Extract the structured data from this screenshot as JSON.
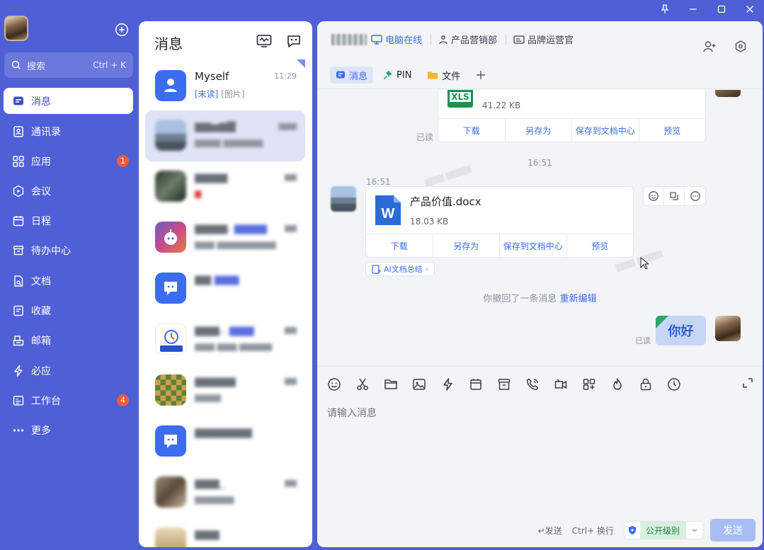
{
  "window": {
    "controls": [
      "pin-icon",
      "minimize-icon",
      "maximize-icon",
      "close-icon"
    ]
  },
  "nav": {
    "search_placeholder": "搜索",
    "search_shortcut": "Ctrl + K",
    "items": [
      {
        "id": "messages",
        "label": "消息",
        "icon": "message-icon",
        "active": true,
        "badge": ""
      },
      {
        "id": "contacts",
        "label": "通讯录",
        "icon": "contacts-icon",
        "active": false,
        "badge": ""
      },
      {
        "id": "apps",
        "label": "应用",
        "icon": "apps-grid-icon",
        "active": false,
        "badge": "1"
      },
      {
        "id": "meeting",
        "label": "会议",
        "icon": "meeting-icon",
        "active": false,
        "badge": ""
      },
      {
        "id": "calendar",
        "label": "日程",
        "icon": "calendar-icon",
        "active": false,
        "badge": ""
      },
      {
        "id": "todo",
        "label": "待办中心",
        "icon": "todo-icon",
        "active": false,
        "badge": ""
      },
      {
        "id": "docs",
        "label": "文档",
        "icon": "document-icon",
        "active": false,
        "badge": ""
      },
      {
        "id": "favorites",
        "label": "收藏",
        "icon": "favorite-icon",
        "active": false,
        "badge": ""
      },
      {
        "id": "mail",
        "label": "邮箱",
        "icon": "mail-icon",
        "active": false,
        "badge": ""
      },
      {
        "id": "ding",
        "label": "必应",
        "icon": "lightning-icon",
        "active": false,
        "badge": ""
      },
      {
        "id": "workbench",
        "label": "工作台",
        "icon": "workbench-icon",
        "active": false,
        "badge": "4"
      },
      {
        "id": "more",
        "label": "更多",
        "icon": "more-dots-icon",
        "active": false,
        "badge": ""
      }
    ]
  },
  "list": {
    "title": "消息",
    "conversations": [
      {
        "name": "Myself",
        "time": "11:29",
        "preview_tag": "[未读]",
        "preview": "[图片]",
        "blur": false
      },
      {
        "name": "",
        "time": "",
        "preview": "",
        "blur": true,
        "selected": true
      },
      {
        "name": "",
        "time": "",
        "preview": "",
        "blur": true
      },
      {
        "name": "",
        "time": "",
        "preview": "",
        "blur": true
      },
      {
        "name": "",
        "time": "",
        "preview": "",
        "blur": true
      },
      {
        "name": "",
        "time": "",
        "preview": "",
        "blur": true
      },
      {
        "name": "",
        "time": "",
        "preview": "",
        "blur": true
      },
      {
        "name": "",
        "time": "",
        "preview": "",
        "blur": true
      },
      {
        "name": "",
        "time": "",
        "preview": "",
        "blur": true
      },
      {
        "name": "",
        "time": "",
        "preview": "",
        "blur": true
      }
    ]
  },
  "chat": {
    "online_label": "电脑在线",
    "tags": [
      "产品营销部",
      "品牌运营官"
    ],
    "tabs": [
      {
        "label": "消息",
        "icon": "message-icon",
        "active": true
      },
      {
        "label": "PIN",
        "icon": "pin-icon",
        "active": false
      },
      {
        "label": "文件",
        "icon": "folder-icon",
        "active": false
      }
    ],
    "file1": {
      "ext": "XLS",
      "size": "41.22 KB",
      "read": "已读",
      "actions": [
        "下载",
        "另存为",
        "保存到文档中心",
        "预览"
      ]
    },
    "time_divider": "16:51",
    "file2": {
      "time": "16:51",
      "name": "产品价值.docx",
      "ext": "W",
      "size": "18.03 KB",
      "actions": [
        "下载",
        "另存为",
        "保存到文档中心",
        "预览"
      ],
      "ai_summary": "AI文档总结"
    },
    "recall": {
      "text": "你撤回了一条消息",
      "link": "重新编辑"
    },
    "hello": {
      "text": "你好",
      "read": "已读"
    }
  },
  "composer": {
    "placeholder": "请输入消息",
    "send_hint": "发送",
    "newline_hint": "Ctrl+ 换行",
    "level": "公开级别",
    "send": "发送"
  },
  "colors": {
    "accent": "#3c6cf0",
    "nav_bg": "#4f5fd6",
    "badge": "#f25b3f"
  }
}
